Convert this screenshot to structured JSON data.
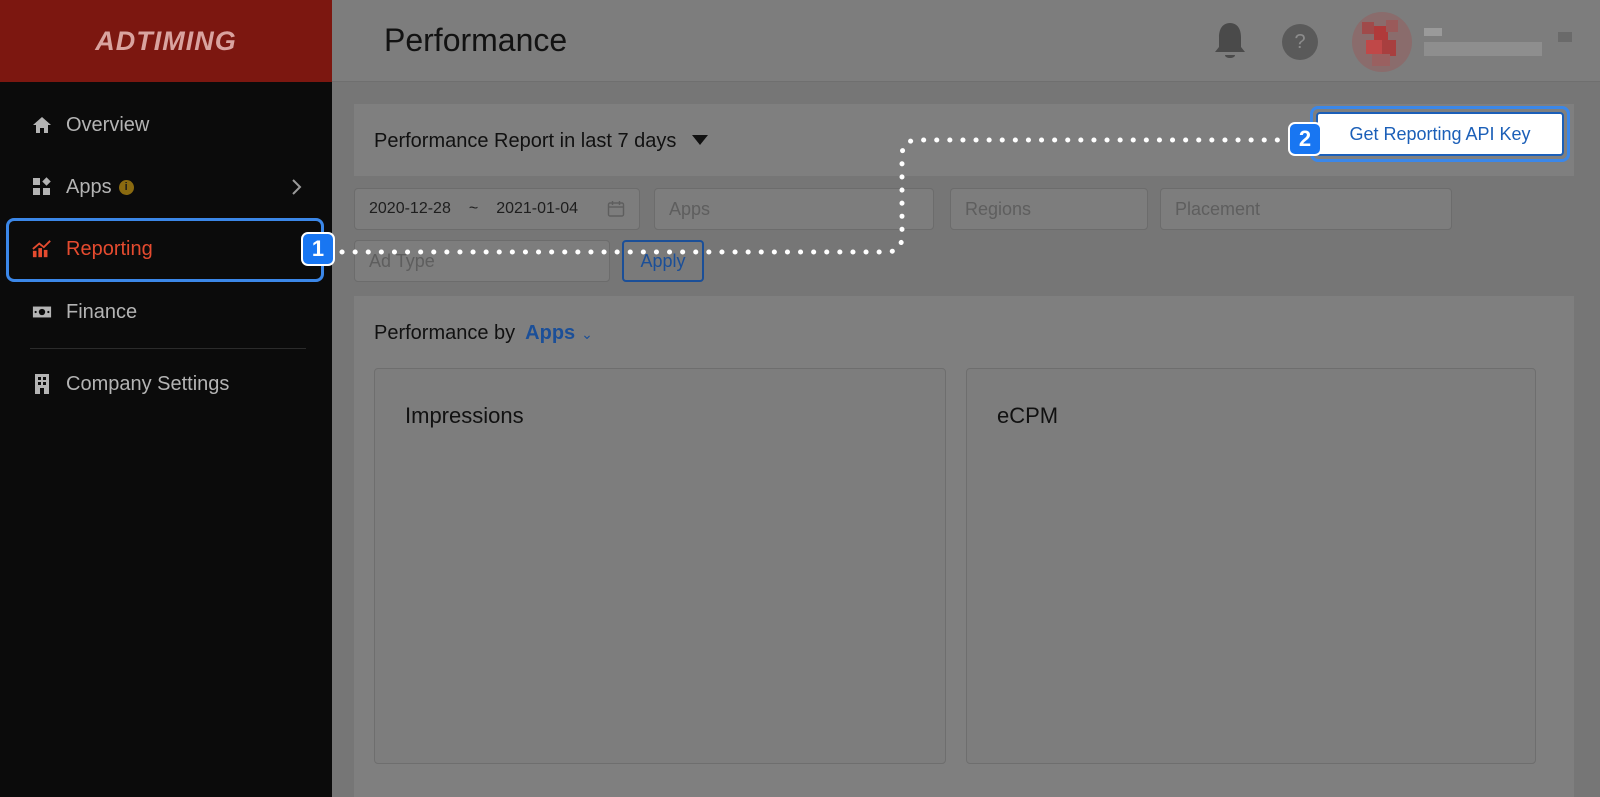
{
  "sidebar": {
    "logo": "ADTIMING",
    "items": [
      {
        "label": "Overview",
        "icon": "home-icon"
      },
      {
        "label": "Apps",
        "icon": "apps-grid-icon",
        "info": "i"
      },
      {
        "label": "Reporting",
        "icon": "chart-icon",
        "active": true
      },
      {
        "label": "Finance",
        "icon": "money-icon"
      },
      {
        "label": "Company Settings",
        "icon": "building-icon"
      }
    ]
  },
  "header": {
    "title": "Performance",
    "help_label": "?"
  },
  "report": {
    "title": "Performance Report in last 7 days",
    "api_button": "Get Reporting API Key",
    "filters": {
      "date_start": "2020-12-28",
      "date_sep": "~",
      "date_end": "2021-01-04",
      "apps_placeholder": "Apps",
      "regions_placeholder": "Regions",
      "placement_placeholder": "Placement",
      "ad_type_placeholder": "Ad Type",
      "apply_label": "Apply"
    }
  },
  "performance": {
    "prefix": "Performance by",
    "group_by": "Apps",
    "cards": [
      {
        "title": "Impressions"
      },
      {
        "title": "eCPM"
      }
    ]
  },
  "annotations": {
    "step1": "1",
    "step2": "2"
  },
  "colors": {
    "accent_red": "#e54b2f",
    "highlight_blue": "#3b87e8",
    "link_blue": "#1b4f98",
    "badge_blue": "#1876f2"
  }
}
